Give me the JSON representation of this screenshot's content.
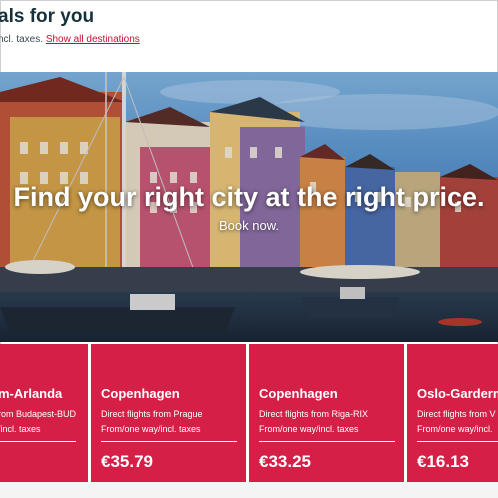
{
  "section": {
    "title": "als for you",
    "subtitle": "ncl. taxes.",
    "show_all_link": "Show all destinations"
  },
  "hero": {
    "headline": "Find your right city at the right price.",
    "cta": "Book now."
  },
  "deals": [
    {
      "city": "m-Arlanda",
      "route": "rom Budapest-BUD",
      "fare": "/incl. taxes",
      "price": ""
    },
    {
      "city": "Copenhagen",
      "route": "Direct flights from Prague",
      "fare": "From/one way/incl. taxes",
      "price": "€35.79"
    },
    {
      "city": "Copenhagen",
      "route": "Direct flights from Riga-RIX",
      "fare": "From/one way/incl. taxes",
      "price": "€33.25"
    },
    {
      "city": "Oslo-Gardermo",
      "route": "Direct flights from V",
      "fare": "From/one way/incl.",
      "price": "€16.13"
    }
  ],
  "colors": {
    "card_background": "#d61f47",
    "title": "#17313b",
    "link": "#c8102e"
  }
}
